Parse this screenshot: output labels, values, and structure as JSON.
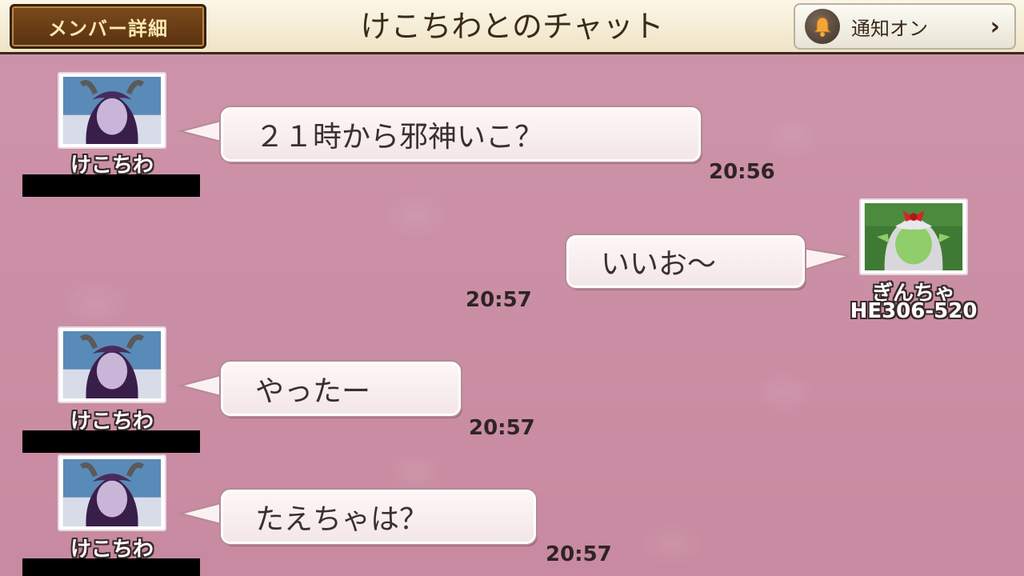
{
  "header": {
    "member_button": "メンバー詳細",
    "title": "けこちわとのチャット",
    "notify_label": "通知オン",
    "notify_chevron": "›"
  },
  "messages": [
    {
      "sender": "けこちわ",
      "text": "２１時から邪神いこ？",
      "time": "20:56",
      "side": "left"
    },
    {
      "sender": "ぎんちゃ",
      "sender_id": "HE306-520",
      "text": "いいお〜",
      "time": "20:57",
      "side": "right"
    },
    {
      "sender": "けこちわ",
      "text": "やったー",
      "time": "20:57",
      "side": "left"
    },
    {
      "sender": "けこちわ",
      "text": "たえちゃは？",
      "time": "20:57",
      "side": "left"
    }
  ],
  "colors": {
    "background": "#c98da3",
    "header_bg": "#fbf6e7",
    "bubble_bg": "#fdf6f6",
    "member_button_bg": "#6a3d14"
  }
}
